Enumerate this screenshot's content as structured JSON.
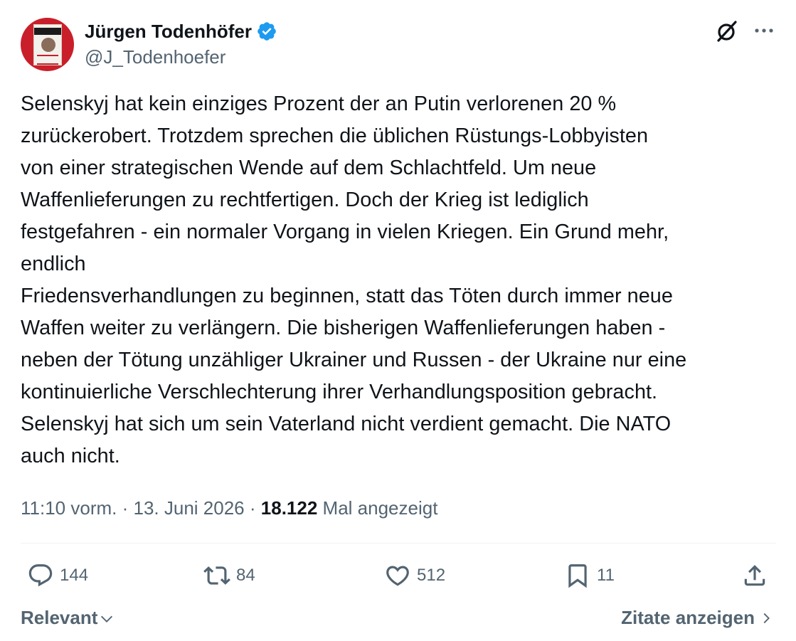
{
  "author": {
    "display_name": "Jürgen Todenhöfer",
    "handle": "@J_Todenhoefer",
    "verified_icon": "verified-badge-icon",
    "avatar_icon": "profile-avatar"
  },
  "header_actions": {
    "grok_icon": "grok-icon",
    "more_icon": "more-dots-icon"
  },
  "tweet": {
    "text": "Selenskyj hat kein einziges Prozent der an Putin verlorenen 20 %\nzurückerobert. Trotzdem sprechen die üblichen Rüstungs-Lobbyisten\nvon einer strategischen Wende auf dem Schlachtfeld. Um neue\nWaffenlieferungen zu rechtfertigen. Doch der Krieg ist lediglich\nfestgefahren - ein normaler Vorgang in vielen Kriegen. Ein Grund mehr,\nendlich\nFriedensverhandlungen zu beginnen, statt das Töten durch immer neue\nWaffen weiter zu verlängern. Die bisherigen Waffenlieferungen haben -\nneben der Tötung unzähliger Ukrainer und Russen - der Ukraine nur eine\nkontinuierliche Verschlechterung ihrer Verhandlungsposition gebracht.\nSelenskyj hat sich um sein Vaterland nicht verdient gemacht. Die NATO\nauch nicht."
  },
  "meta": {
    "time": "11:10 vorm.",
    "separator": "·",
    "date": "13. Juni 2026",
    "views_count": "18.122",
    "views_label": "Mal angezeigt"
  },
  "actions": {
    "replies": "144",
    "reposts": "84",
    "likes": "512",
    "bookmarks": "11"
  },
  "footer": {
    "sort_label": "Relevant",
    "quotes_label": "Zitate anzeigen"
  },
  "colors": {
    "text_primary": "#0f1419",
    "text_secondary": "#536471",
    "verified_blue": "#1d9bf0",
    "divider": "#eff3f4"
  }
}
